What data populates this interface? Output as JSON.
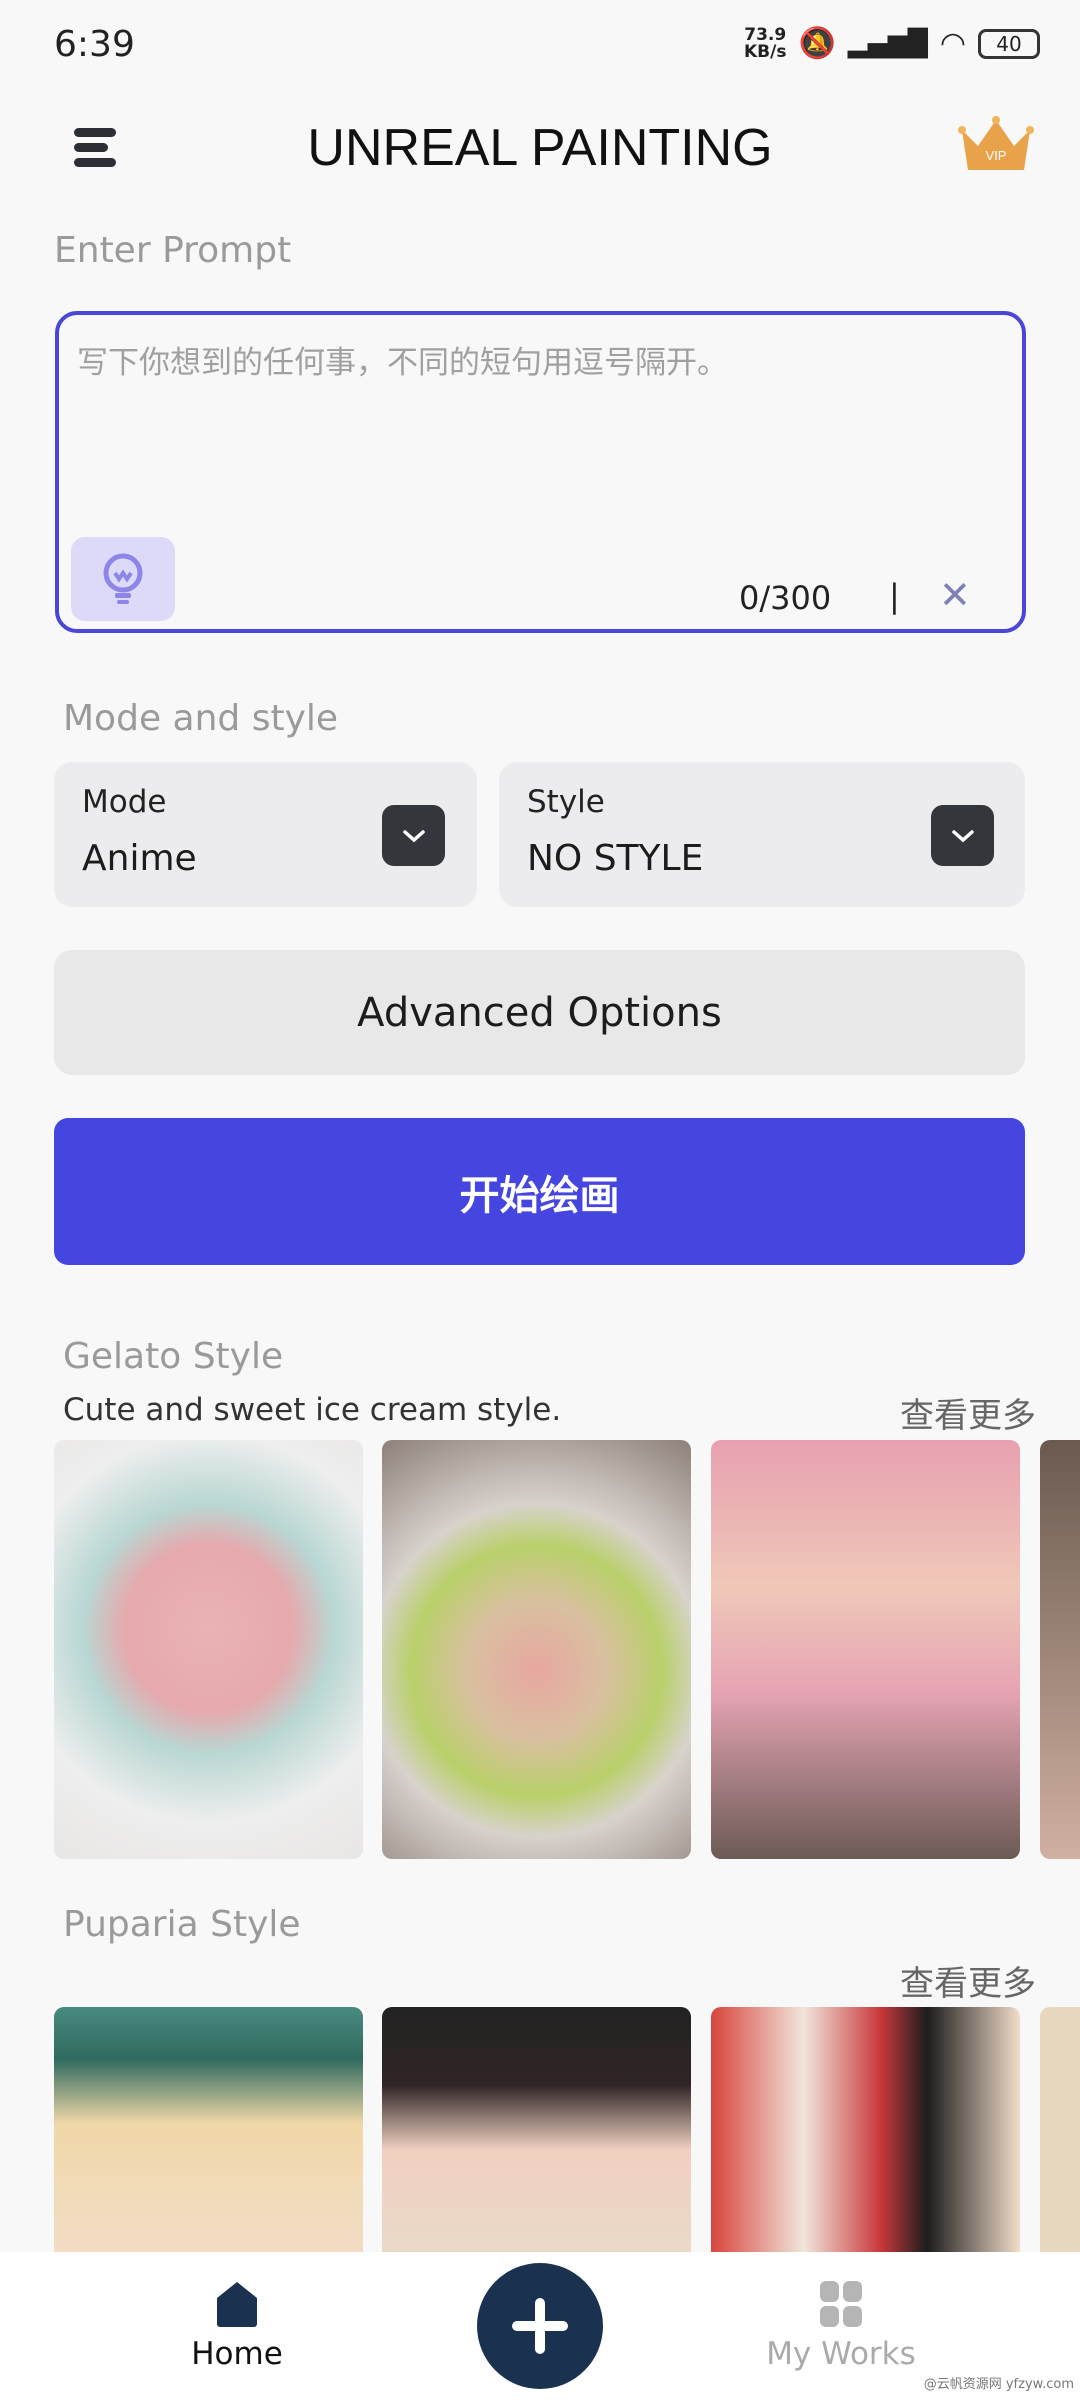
{
  "status": {
    "time": "6:39",
    "speed": "73.9",
    "speed_unit": "KB/s",
    "battery": "40"
  },
  "header": {
    "title": "UNREAL PAINTING",
    "menu_icon": "hamburger-icon",
    "vip_icon": "vip-crown-icon",
    "vip_label": "VIP"
  },
  "prompt": {
    "label": "Enter Prompt",
    "placeholder": "写下你想到的任何事，不同的短句用逗号隔开。",
    "value": "",
    "count": "0/300",
    "cursor": "|",
    "clear": "✕",
    "accent": "#4a46d8"
  },
  "mode_style": {
    "label": "Mode and style",
    "mode": {
      "label": "Mode",
      "value": "Anime"
    },
    "style": {
      "label": "Style",
      "value": "NO STYLE"
    }
  },
  "advanced_label": "Advanced Options",
  "start_label": "开始绘画",
  "start_color": "#4545e0",
  "sections": [
    {
      "title": "Gelato Style",
      "subtitle": "Cute and sweet ice cream style.",
      "more": "查看更多",
      "images": [
        "ice-cream-heart",
        "ice-cream-apple",
        "ice-cream-girl",
        "ice-cream-partial"
      ]
    },
    {
      "title": "Puparia Style",
      "subtitle": "",
      "more": "查看更多",
      "images": [
        "anime-girl-green-cap",
        "anime-girl-witch-hat",
        "anime-girl-red-cap",
        "anime-partial"
      ]
    }
  ],
  "nav": {
    "home": "Home",
    "add": "+",
    "works": "My Works"
  },
  "watermark": "@云帆资源网 yfzyw.com"
}
